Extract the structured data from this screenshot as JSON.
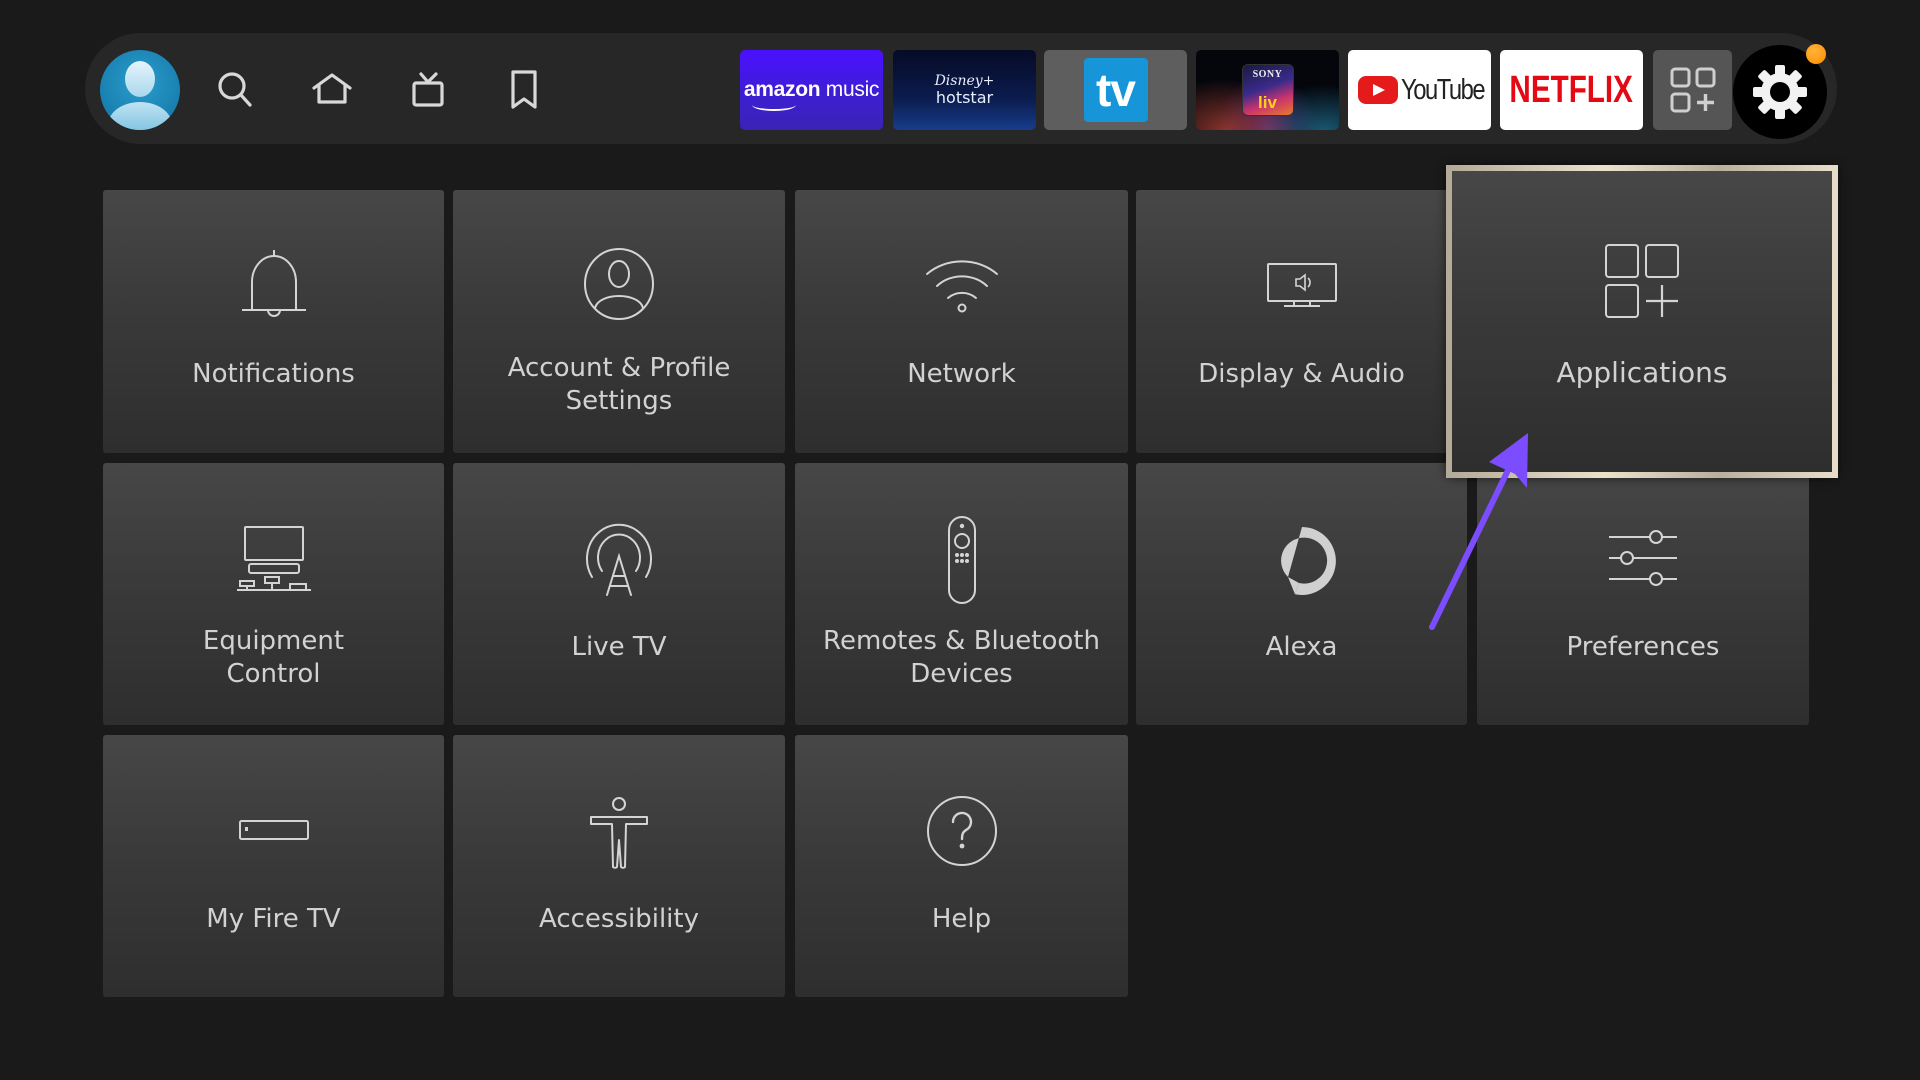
{
  "top_bar": {
    "profile": {
      "icon": "user-avatar-icon"
    },
    "nav": [
      {
        "id": "search",
        "icon": "search-icon"
      },
      {
        "id": "home",
        "icon": "home-icon"
      },
      {
        "id": "live",
        "icon": "live-tv-icon"
      },
      {
        "id": "watchlist",
        "icon": "bookmark-icon"
      }
    ],
    "apps": {
      "amazon_music": {
        "part1": "amazon",
        "part2": "music"
      },
      "hotstar": {
        "line1": "Disney+",
        "line2": "hotstar"
      },
      "tv": {
        "label": "tv"
      },
      "sonyliv": {
        "top": "SONY",
        "bottom": "liv"
      },
      "youtube": {
        "label": "YouTube"
      },
      "netflix": {
        "label": "NETFLIX"
      },
      "all_apps": {
        "icon": "apps-grid-plus-icon"
      }
    },
    "settings": {
      "icon": "gear-icon",
      "notification_dot_color": "#ff9500"
    }
  },
  "settings_grid": {
    "tiles": [
      {
        "id": "notifications",
        "label": "Notifications",
        "icon": "bell-icon"
      },
      {
        "id": "account",
        "label_line1": "Account & Profile",
        "label_line2": "Settings",
        "icon": "account-icon"
      },
      {
        "id": "network",
        "label": "Network",
        "icon": "wifi-icon"
      },
      {
        "id": "display_audio",
        "label": "Display & Audio",
        "icon": "display-audio-icon"
      },
      {
        "id": "applications",
        "label": "Applications",
        "icon": "applications-icon",
        "focused": true
      },
      {
        "id": "equipment",
        "label_line1": "Equipment",
        "label_line2": "Control",
        "icon": "equipment-icon"
      },
      {
        "id": "live_tv",
        "label": "Live TV",
        "icon": "antenna-icon"
      },
      {
        "id": "remotes",
        "label_line1": "Remotes & Bluetooth",
        "label_line2": "Devices",
        "icon": "remote-icon"
      },
      {
        "id": "alexa",
        "label": "Alexa",
        "icon": "alexa-icon"
      },
      {
        "id": "preferences",
        "label": "Preferences",
        "icon": "sliders-icon"
      },
      {
        "id": "my_fire_tv",
        "label": "My Fire TV",
        "icon": "fire-tv-device-icon"
      },
      {
        "id": "accessibility",
        "label": "Accessibility",
        "icon": "accessibility-icon"
      },
      {
        "id": "help",
        "label": "Help",
        "icon": "help-icon"
      }
    ]
  },
  "annotation": {
    "type": "arrow",
    "color": "#7b4dff",
    "points_to": "Applications"
  }
}
